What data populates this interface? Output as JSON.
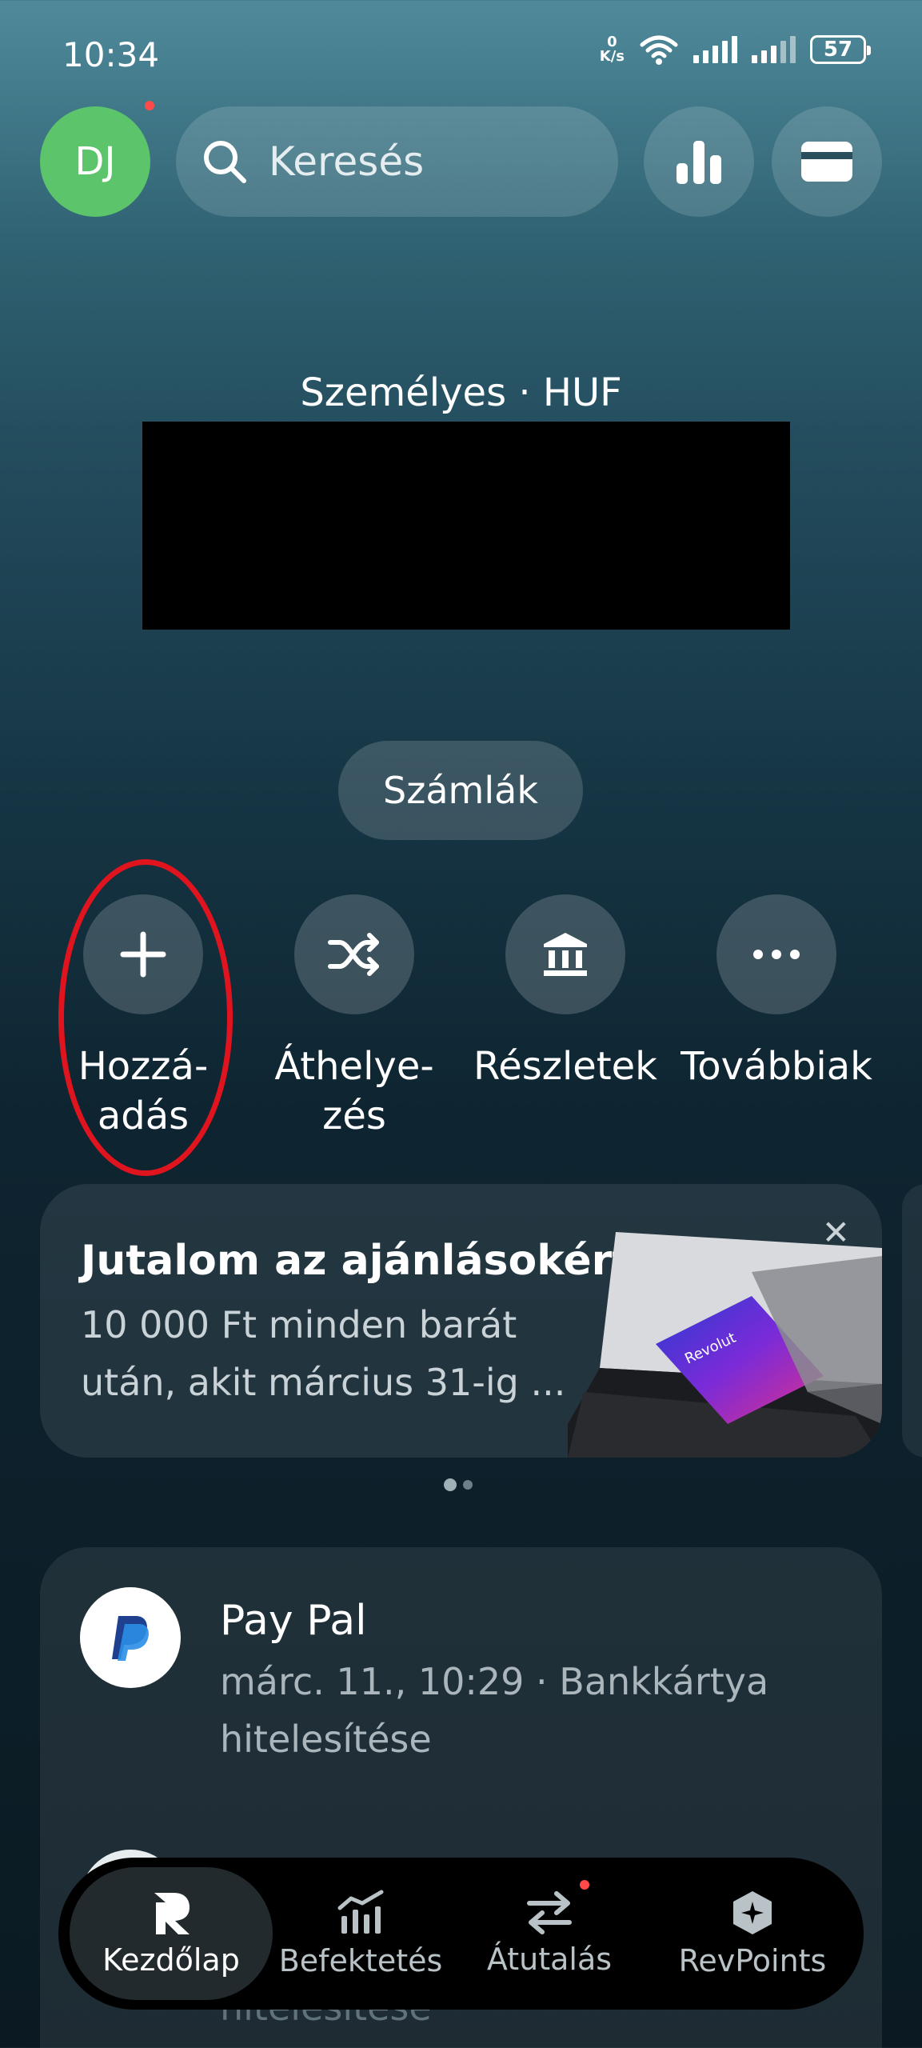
{
  "status_bar": {
    "time": "10:34",
    "speed_value": "0",
    "speed_unit": "K/s",
    "battery": "57"
  },
  "header": {
    "avatar_initials": "DJ",
    "search_placeholder": "Keresés"
  },
  "account": {
    "label": "Személyes · HUF",
    "accounts_button": "Számlák"
  },
  "actions": [
    {
      "label": "Hozzá-\nadás",
      "icon": "plus-icon"
    },
    {
      "label": "Áthelye-\nzés",
      "icon": "shuffle-icon"
    },
    {
      "label": "Részletek",
      "icon": "bank-icon"
    },
    {
      "label": "Továbbiak",
      "icon": "more-icon"
    }
  ],
  "promo": {
    "title": "Jutalom az ajánlásokért",
    "subtitle": "10 000 Ft minden barát után, akit március 31-ig ...",
    "card_brand": "Revolut"
  },
  "transactions": [
    {
      "name": "Pay Pal",
      "detail": "márc. 11., 10:29 · Bankkártya hitelesítése"
    },
    {
      "name": "",
      "detail": "hitelesítése"
    }
  ],
  "nav": [
    {
      "label": "Kezdőlap",
      "icon": "revolut-r-icon",
      "active": true
    },
    {
      "label": "Befektetés",
      "icon": "invest-chart-icon",
      "active": false
    },
    {
      "label": "Átutalás",
      "icon": "transfer-arrows-icon",
      "active": false
    },
    {
      "label": "RevPoints",
      "icon": "revpoints-icon",
      "active": false
    }
  ],
  "colors": {
    "avatar_bg": "#5cc46b",
    "highlight": "#e0141e",
    "notification_dot": "#ff4a4a"
  }
}
